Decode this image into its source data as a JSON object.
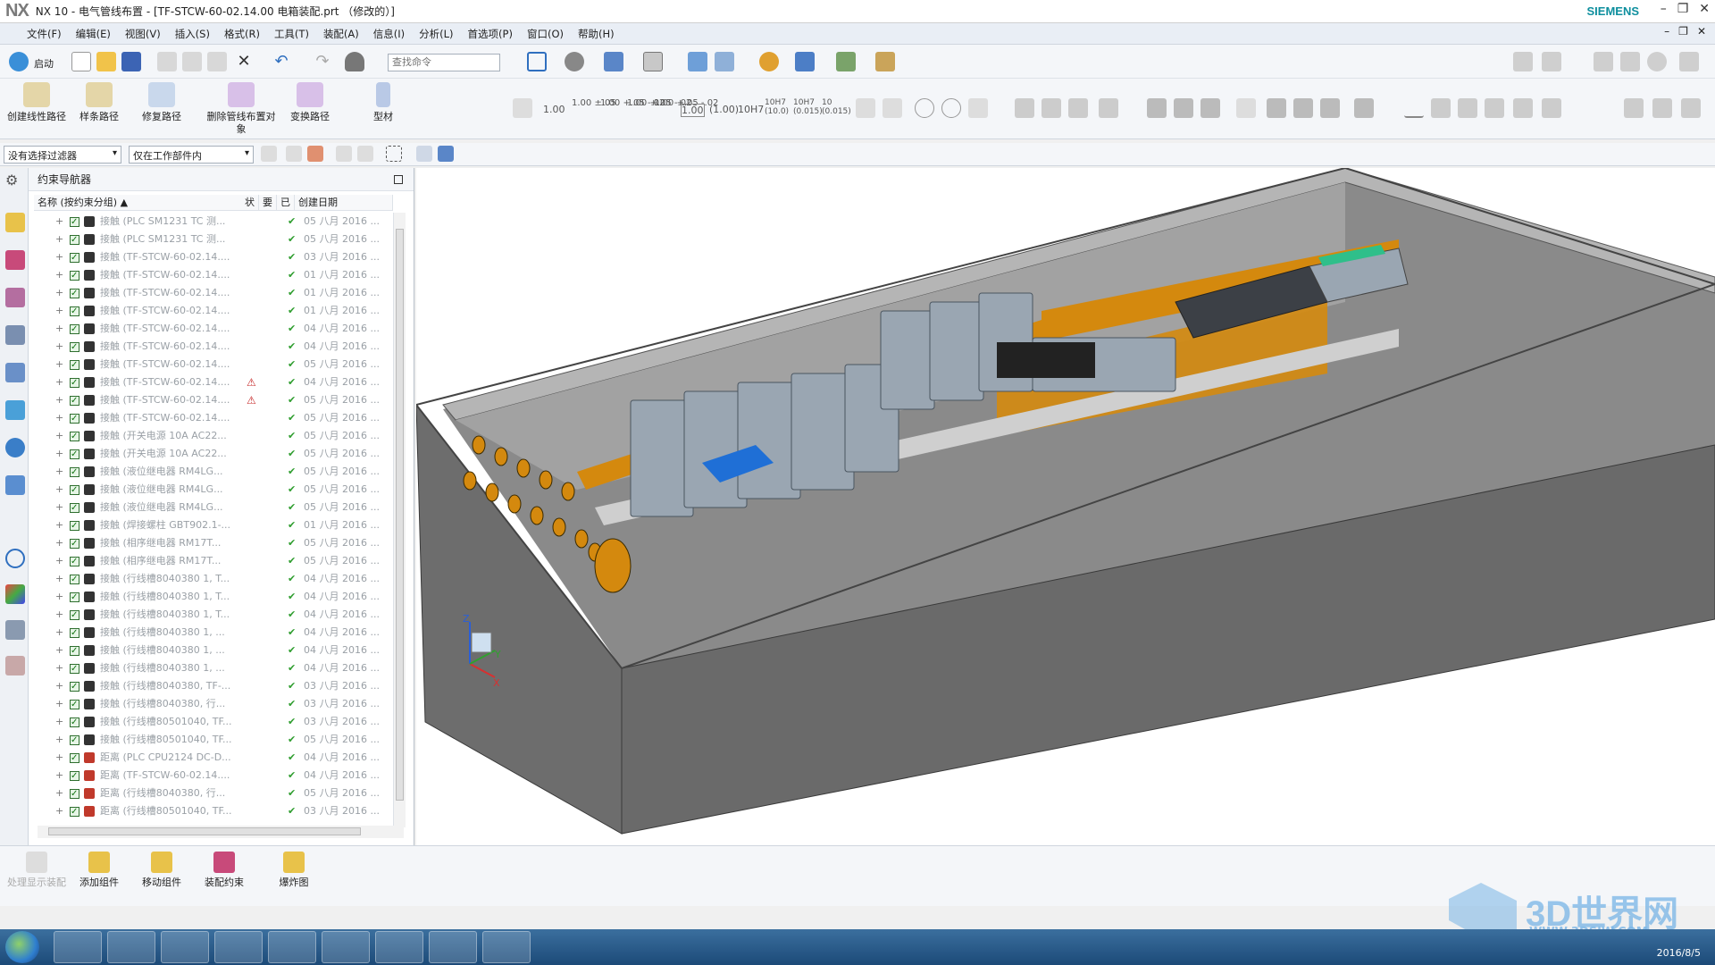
{
  "window": {
    "logo": "NX",
    "title": "NX 10 - 电气管线布置 - [TF-STCW-60-02.14.00 电箱装配.prt （修改的）]",
    "brand": "SIEMENS",
    "controls": [
      "–",
      "❐",
      "✕"
    ]
  },
  "menu": [
    "文件(F)",
    "编辑(E)",
    "视图(V)",
    "插入(S)",
    "格式(R)",
    "工具(T)",
    "装配(A)",
    "信息(I)",
    "分析(L)",
    "首选项(P)",
    "窗口(O)",
    "帮助(H)"
  ],
  "toolbar": {
    "start_label": "启动",
    "search_placeholder": "查找命令"
  },
  "ribbon": {
    "buttons": [
      {
        "label": "创建线性路径"
      },
      {
        "label": "样条路径"
      },
      {
        "label": "修复路径"
      },
      {
        "label": "删除管线布置对象"
      },
      {
        "label": "变换路径"
      },
      {
        "label": "型材"
      }
    ],
    "tolerances": [
      "1.00",
      "1.00 ±.05",
      "1.00 +.05 -.02",
      "1.00 +.05 -.02",
      "1.00 +.05 -.02",
      "1.00",
      "(1.00)",
      "10H7",
      "10H7 (10.0)",
      "10H7 (0.015)",
      "10 (0.015)"
    ]
  },
  "filters": {
    "selection_filter": "没有选择过滤器",
    "scope": "仅在工作部件内"
  },
  "navigator": {
    "title": "约束导航器",
    "columns": [
      "名称 (按约束分组)",
      "状",
      "要",
      "已",
      "创建日期"
    ],
    "rows": [
      {
        "type": "touch",
        "name": "接触 (PLC SM1231 TC  测...",
        "date": "05 八月 2016 ...",
        "warn": false
      },
      {
        "type": "touch",
        "name": "接触 (PLC SM1231 TC  测...",
        "date": "05 八月 2016 ...",
        "warn": false
      },
      {
        "type": "touch",
        "name": "接触 (TF-STCW-60-02.14....",
        "date": "03 八月 2016 ...",
        "warn": false
      },
      {
        "type": "touch",
        "name": "接触 (TF-STCW-60-02.14....",
        "date": "01 八月 2016 ...",
        "warn": false
      },
      {
        "type": "touch",
        "name": "接触 (TF-STCW-60-02.14....",
        "date": "01 八月 2016 ...",
        "warn": false
      },
      {
        "type": "touch",
        "name": "接触 (TF-STCW-60-02.14....",
        "date": "01 八月 2016 ...",
        "warn": false
      },
      {
        "type": "touch",
        "name": "接触 (TF-STCW-60-02.14....",
        "date": "04 八月 2016 ...",
        "warn": false
      },
      {
        "type": "touch",
        "name": "接触 (TF-STCW-60-02.14....",
        "date": "04 八月 2016 ...",
        "warn": false
      },
      {
        "type": "touch",
        "name": "接触 (TF-STCW-60-02.14....",
        "date": "05 八月 2016 ...",
        "warn": false
      },
      {
        "type": "touch",
        "name": "接触 (TF-STCW-60-02.14....",
        "date": "04 八月 2016 ...",
        "warn": true
      },
      {
        "type": "touch",
        "name": "接触 (TF-STCW-60-02.14....",
        "date": "05 八月 2016 ...",
        "warn": true
      },
      {
        "type": "touch",
        "name": "接触 (TF-STCW-60-02.14....",
        "date": "05 八月 2016 ...",
        "warn": false
      },
      {
        "type": "touch",
        "name": "接触 (开关电源 10A AC22...",
        "date": "05 八月 2016 ...",
        "warn": false
      },
      {
        "type": "touch",
        "name": "接触 (开关电源 10A AC22...",
        "date": "05 八月 2016 ...",
        "warn": false
      },
      {
        "type": "touch",
        "name": "接触 (液位继电器 RM4LG...",
        "date": "05 八月 2016 ...",
        "warn": false
      },
      {
        "type": "touch",
        "name": "接触 (液位继电器 RM4LG...",
        "date": "05 八月 2016 ...",
        "warn": false
      },
      {
        "type": "touch",
        "name": "接触 (液位继电器 RM4LG...",
        "date": "05 八月 2016 ...",
        "warn": false
      },
      {
        "type": "touch",
        "name": "接触 (焊接螺柱 GBT902.1-...",
        "date": "01 八月 2016 ...",
        "warn": false
      },
      {
        "type": "touch",
        "name": "接触 (相序继电器 RM17T...",
        "date": "05 八月 2016 ...",
        "warn": false
      },
      {
        "type": "touch",
        "name": "接触 (相序继电器 RM17T...",
        "date": "05 八月 2016 ...",
        "warn": false
      },
      {
        "type": "touch",
        "name": "接触 (行线槽8040380 1, T...",
        "date": "04 八月 2016 ...",
        "warn": false
      },
      {
        "type": "touch",
        "name": "接触 (行线槽8040380 1, T...",
        "date": "04 八月 2016 ...",
        "warn": false
      },
      {
        "type": "touch",
        "name": "接触 (行线槽8040380 1, T...",
        "date": "04 八月 2016 ...",
        "warn": false
      },
      {
        "type": "touch",
        "name": "接触 (行线槽8040380 1, ...",
        "date": "04 八月 2016 ...",
        "warn": false
      },
      {
        "type": "touch",
        "name": "接触 (行线槽8040380 1, ...",
        "date": "04 八月 2016 ...",
        "warn": false
      },
      {
        "type": "touch",
        "name": "接触 (行线槽8040380 1, ...",
        "date": "04 八月 2016 ...",
        "warn": false
      },
      {
        "type": "touch",
        "name": "接触 (行线槽8040380, TF-...",
        "date": "03 八月 2016 ...",
        "warn": false
      },
      {
        "type": "touch",
        "name": "接触 (行线槽8040380, 行...",
        "date": "03 八月 2016 ...",
        "warn": false
      },
      {
        "type": "touch",
        "name": "接触 (行线槽80501040, TF...",
        "date": "03 八月 2016 ...",
        "warn": false
      },
      {
        "type": "touch",
        "name": "接触 (行线槽80501040, TF...",
        "date": "05 八月 2016 ...",
        "warn": false
      },
      {
        "type": "distance",
        "name": "距离 (PLC CPU2124 DC-D...",
        "date": "04 八月 2016 ...",
        "warn": false
      },
      {
        "type": "distance",
        "name": "距离 (TF-STCW-60-02.14....",
        "date": "04 八月 2016 ...",
        "warn": false
      },
      {
        "type": "distance",
        "name": "距离 (行线槽8040380, 行...",
        "date": "05 八月 2016 ...",
        "warn": false
      },
      {
        "type": "distance",
        "name": "距离 (行线槽80501040, TF...",
        "date": "03 八月 2016 ...",
        "warn": false
      }
    ]
  },
  "bottom_toolbar": [
    "处理显示装配",
    "添加组件",
    "移动组件",
    "装配约束",
    "爆炸图"
  ],
  "viewport": {
    "triad": {
      "z": "Z",
      "y": "Y",
      "x": "X"
    }
  },
  "taskbar": {
    "date": "2016/8/5"
  },
  "watermark": {
    "text": "3D世界网",
    "url": "WWW.3DSJW.COM"
  },
  "colors": {
    "accent": "#0e8f9e",
    "wireduct": "#d4890e",
    "enclosure": "#6d6d6d"
  }
}
